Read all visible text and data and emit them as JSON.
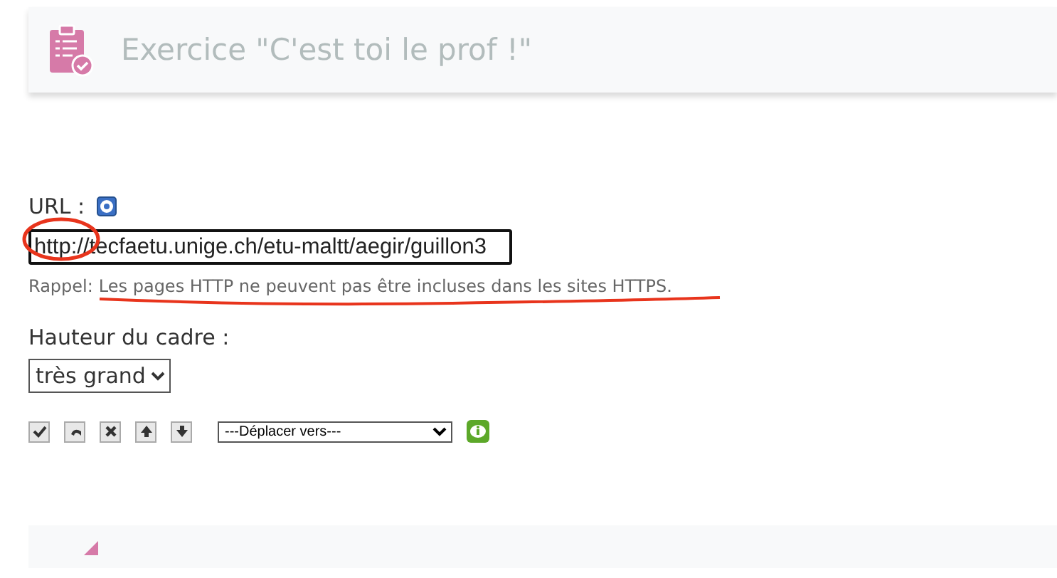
{
  "header": {
    "title": "Exercice \"C'est toi le prof !\""
  },
  "url_field": {
    "label": "URL :",
    "value": "http://tecfaetu.unige.ch/etu-maltt/aegir/guillon3"
  },
  "reminder": {
    "label": "Rappel:",
    "text": "Les pages HTTP ne peuvent pas être incluses dans les sites HTTPS."
  },
  "frame_height": {
    "label": "Hauteur du cadre :",
    "value": "très grand"
  },
  "toolbar": [
    {
      "kind": "check"
    },
    {
      "kind": "undo"
    },
    {
      "kind": "delete"
    },
    {
      "kind": "up"
    },
    {
      "kind": "down"
    }
  ],
  "move_select": {
    "value": "---Déplacer vers---"
  }
}
